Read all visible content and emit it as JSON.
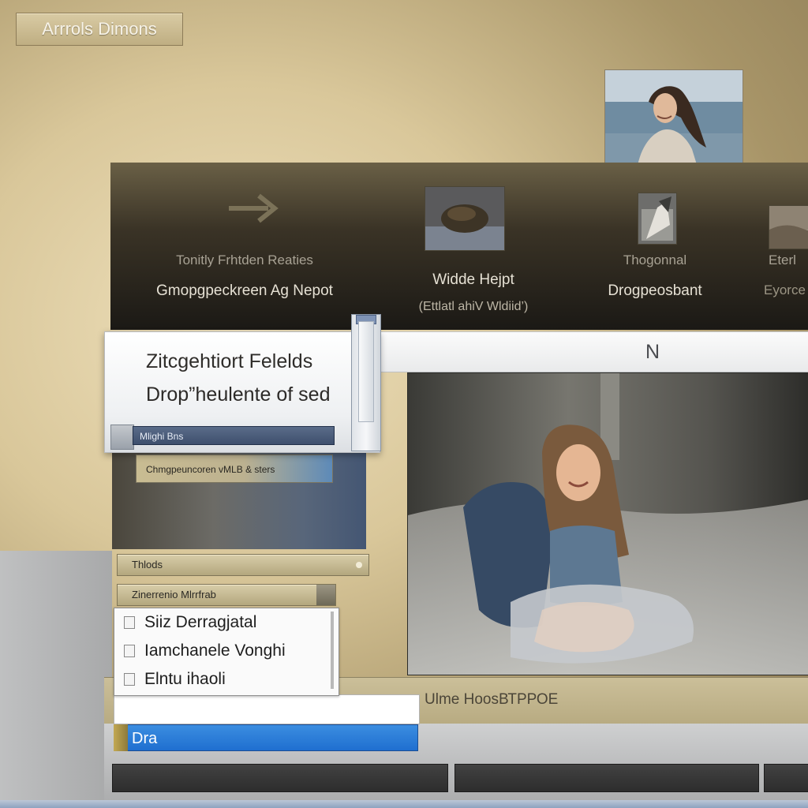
{
  "window": {
    "title": "Arrrols Dimons"
  },
  "carousel": {
    "items": [
      {
        "line1": "Tonitly Frhtden Reaties",
        "line2": "Gmopgpeckreen Ag Nepot",
        "thumb": "arrow-icon"
      },
      {
        "line1": "",
        "line2": "Widde Hejpt",
        "line3": "(Ettlatl ahiV Wldiid’)",
        "thumb": "rock-photo"
      },
      {
        "line1": "Thogonnal",
        "line2": "Drogpeosbant",
        "thumb": "figure-photo"
      },
      {
        "line1": "Eterl",
        "line2": "Eyorce",
        "thumb": "landscape-photo"
      }
    ]
  },
  "panel": {
    "title": "Zitcgehtiort Felelds",
    "subtitle": "Drop”heulente of sed",
    "field_value": "Mlighi Bns",
    "tag_label": "Chmgpeuncoren vMLB & sters"
  },
  "header": {
    "label": "N"
  },
  "controls": {
    "pill1_label": "Thlods",
    "pill2_label": "Zinerrenio Mlrrfrab"
  },
  "list": {
    "items": [
      {
        "label": "Siiz Derragjatal"
      },
      {
        "label": "Iamchanele Vonghi"
      },
      {
        "label": "Elntu ihaoli"
      }
    ]
  },
  "shelf": {
    "label": "Ulme HoosВТРРОЕ"
  },
  "blue_bar": {
    "label": "Dra"
  },
  "colors": {
    "accent_blue": "#1f6fd0",
    "panel_gold": "#c9bc92",
    "band_dark": "#1b1915"
  }
}
